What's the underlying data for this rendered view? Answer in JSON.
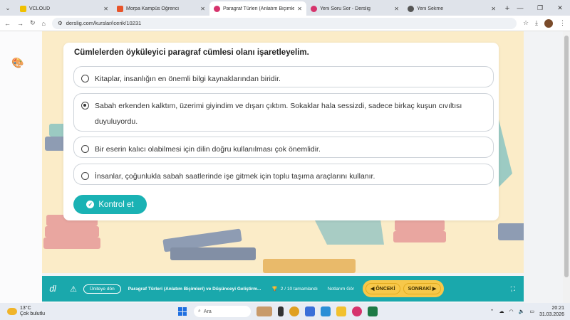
{
  "browser": {
    "tabs": [
      {
        "label": "VCLOUD",
        "color": "#3a3a3a",
        "active": false
      },
      {
        "label": "Morpa Kampüs Öğrenci",
        "color": "#e8542a",
        "active": false
      },
      {
        "label": "Paragraf Türleri (Anlatım Biçimle",
        "color": "#d6336c",
        "active": true
      },
      {
        "label": "Yeni Soru Sor - Derslig",
        "color": "#d6336c",
        "active": false
      },
      {
        "label": "Yeni Sekme",
        "color": "#555555",
        "active": false
      }
    ],
    "url": "derslig.com/kurslar/icerik/10231"
  },
  "question": {
    "title": "Cümlelerden öyküleyici paragraf cümlesi olanı işaretleyelim.",
    "options": [
      {
        "text": "Kitaplar, insanlığın en önemli bilgi kaynaklarından biridir.",
        "selected": false
      },
      {
        "text": "Sabah erkenden kalktım, üzerimi giyindim ve dışarı çıktım. Sokaklar hala sessizdi, sadece birkaç kuşun cıvıltısı duyuluyordu.",
        "selected": true
      },
      {
        "text": "Bir eserin kalıcı olabilmesi için dilin doğru kullanılması çok önemlidir.",
        "selected": false
      },
      {
        "text": "İnsanlar, çoğunlukla sabah saatlerinde işe gitmek için toplu taşıma araçlarını kullanır.",
        "selected": false
      }
    ],
    "check_label": "Kontrol et"
  },
  "footer": {
    "logo": "dl",
    "back_label": "Üniteye dön",
    "breadcrumb": "Paragraf Türleri (Anlatım Biçimleri) ve Düşünceyi Geliştirm...",
    "progress_text": "2 / 10 tamamlandı",
    "notes_label": "Notlarım Gör",
    "prev_label": "ÖNCEKİ",
    "next_label": "SONRAKİ"
  },
  "taskbar": {
    "temp": "13°C",
    "weather": "Çok bulutlu",
    "search": "Ara",
    "time": "20:21",
    "date": "31.03.2026"
  },
  "colors": {
    "accent": "#1ab2b4",
    "footer": "#1aa8ac",
    "nav": "#f7c84a",
    "stage": "#fbecc8"
  }
}
